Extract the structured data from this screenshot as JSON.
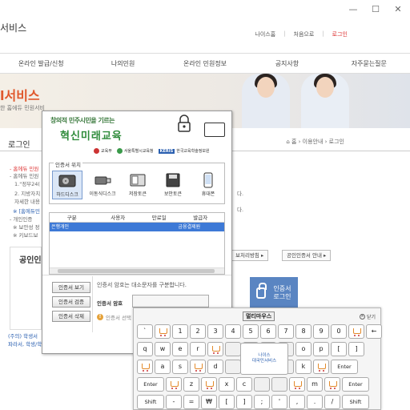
{
  "site": {
    "title": "서비스",
    "top_links": [
      "나이스홈",
      "처음으로",
      "로그인"
    ]
  },
  "nav": [
    "온라인 발급/신청",
    "나의민원",
    "온라인 민원정보",
    "공지사항",
    "자주묻는질문"
  ],
  "banner": {
    "title": "l서비스",
    "subtitle": "한 홈에듀 민원서비"
  },
  "content": {
    "title": "로그인",
    "breadcrumb": "⌂ 홈 › 이용안내 › 로그인",
    "notes": [
      "- 홈에듀 민원",
      "- 홈에듀 민원",
      "1.\"정부24(",
      "2. 지방자치",
      "자세한 내용",
      "※ [홈에듀민",
      "- 개인인증",
      "※ 보안성 정",
      "※ 키보드보"
    ],
    "bg_buttons": [
      "보처리방침 ▸",
      "공인인증서 안내 ▸"
    ],
    "right_dots": [
      "다.",
      "다."
    ],
    "box_title": "공인인",
    "gov_login": {
      "line1": "인증서",
      "line2": "로그인"
    },
    "footer_1": "(주의) 학생서",
    "footer_2": "파라서, 학생/학부모서비스 이용 중에 홈에듀 민원서비"
  },
  "dialog": {
    "slogan_1": "창의적 민주시민을 기르는",
    "slogan_2": "혁신미래교육",
    "sponsors": [
      "교육부",
      "서울특별시교육청",
      "KERIS",
      "한국교육학술정보원"
    ],
    "location_legend": "인증서 위치",
    "locations": [
      {
        "label": "하드디스크",
        "icon": "hard-disk-icon",
        "selected": true
      },
      {
        "label": "이동식디스크",
        "icon": "usb-drive-icon",
        "selected": false
      },
      {
        "label": "저장토큰",
        "icon": "storage-token-icon",
        "selected": false
      },
      {
        "label": "보안토큰",
        "icon": "security-token-icon",
        "selected": false
      },
      {
        "label": "휴대폰",
        "icon": "mobile-phone-icon",
        "selected": false
      }
    ],
    "table": {
      "headers": [
        "구분",
        "사용자",
        "만료일",
        "발급자"
      ],
      "rows": [
        [
          "은행개인",
          "",
          "",
          "금융결제원"
        ]
      ]
    },
    "buttons": [
      "인증서 보기",
      "인증서 검증",
      "인증서 삭제"
    ],
    "password_hint": "인증서 암호는 대소문자를 구분합니다.",
    "password_label": "인증서 암호",
    "password_value": "",
    "select_hint": "인증서 선택"
  },
  "keyboard": {
    "title": "멀티마우스",
    "close_label": "닫기",
    "center_logo": "나이스\n대국민서비스",
    "row1": [
      "`",
      "🛒",
      "1",
      "2",
      "3",
      "4",
      "5",
      "6",
      "7",
      "8",
      "9",
      "0",
      "🛒",
      "←"
    ],
    "row2": [
      "q",
      "w",
      "e",
      "r",
      "🛒",
      "",
      "",
      "",
      "",
      "o",
      "p",
      "[",
      "]"
    ],
    "row3": [
      "🛒",
      "a",
      "s",
      "🛒",
      "d",
      "",
      "",
      "",
      "",
      "k",
      "🛒",
      "Enter"
    ],
    "row4": [
      "Enter",
      "🛒",
      "z",
      "🛒",
      "x",
      "c",
      "",
      "",
      "🛒",
      "m",
      "🛒",
      "Enter"
    ],
    "row5": [
      "Shift",
      "-",
      "=",
      "₩",
      "[",
      "]",
      ";",
      "'",
      ",",
      ".",
      "/",
      "Shift"
    ]
  }
}
